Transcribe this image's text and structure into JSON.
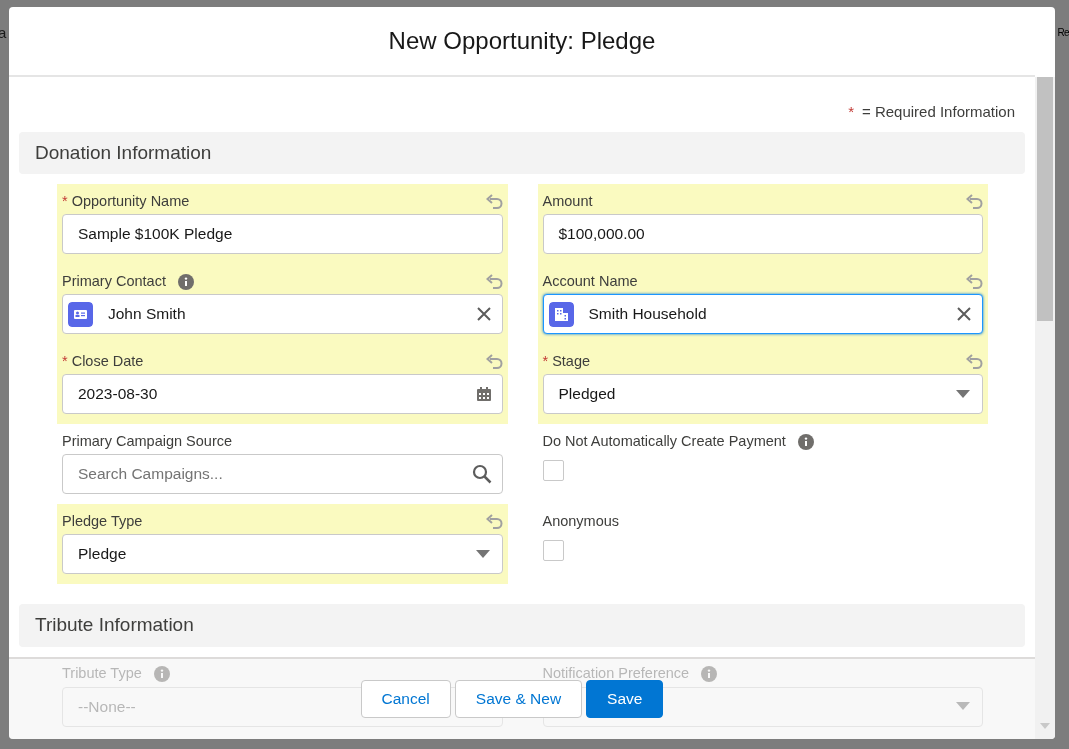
{
  "backdrop": {
    "fragments": [
      "a",
      "Re"
    ]
  },
  "modal": {
    "title": "New Opportunity: Pledge"
  },
  "required_legend": {
    "mark": "*",
    "text": "= Required Information"
  },
  "sections": [
    {
      "title": "Donation Information",
      "rows": [
        [
          {
            "label": "Opportunity Name",
            "kind": "text",
            "required": true,
            "info": false,
            "changed": true,
            "focused": false,
            "value": "Sample $100K Pledge"
          },
          {
            "label": "Amount",
            "kind": "text",
            "required": false,
            "info": false,
            "changed": true,
            "focused": false,
            "value": "$100,000.00"
          }
        ],
        [
          {
            "label": "Primary Contact",
            "kind": "contact_lookup",
            "required": false,
            "info": true,
            "changed": true,
            "focused": false,
            "value": "John Smith"
          },
          {
            "label": "Account Name",
            "kind": "account_lookup",
            "required": false,
            "info": false,
            "changed": true,
            "focused": true,
            "value": "Smith Household"
          }
        ],
        [
          {
            "label": "Close Date",
            "kind": "date",
            "required": true,
            "info": false,
            "changed": true,
            "focused": false,
            "value": "2023-08-30"
          },
          {
            "label": "Stage",
            "kind": "select",
            "required": true,
            "info": false,
            "changed": true,
            "focused": false,
            "value": "Pledged"
          }
        ],
        [
          {
            "label": "Primary Campaign Source",
            "kind": "search",
            "required": false,
            "info": false,
            "changed": false,
            "focused": false,
            "placeholder": "Search Campaigns..."
          },
          {
            "label": "Do Not Automatically Create Payment",
            "kind": "checkbox",
            "required": false,
            "info": true,
            "changed": false,
            "checked": false
          }
        ],
        [
          {
            "label": "Pledge Type",
            "kind": "select",
            "required": false,
            "info": false,
            "changed": true,
            "focused": false,
            "value": "Pledge"
          },
          {
            "label": "Anonymous",
            "kind": "checkbox",
            "required": false,
            "info": false,
            "changed": false,
            "checked": false
          }
        ]
      ]
    },
    {
      "title": "Tribute Information",
      "rows": [
        [
          {
            "label": "Tribute Type",
            "kind": "select",
            "required": false,
            "info": true,
            "changed": false,
            "focused": false,
            "value": "--None--"
          },
          {
            "label": "Notification Preference",
            "kind": "select",
            "required": false,
            "info": true,
            "changed": false,
            "focused": false
          }
        ]
      ]
    }
  ],
  "footer": {
    "buttons": [
      {
        "label": "Cancel",
        "kind": "neutral"
      },
      {
        "label": "Save & New",
        "kind": "neutral"
      },
      {
        "label": "Save",
        "kind": "brand"
      }
    ]
  }
}
